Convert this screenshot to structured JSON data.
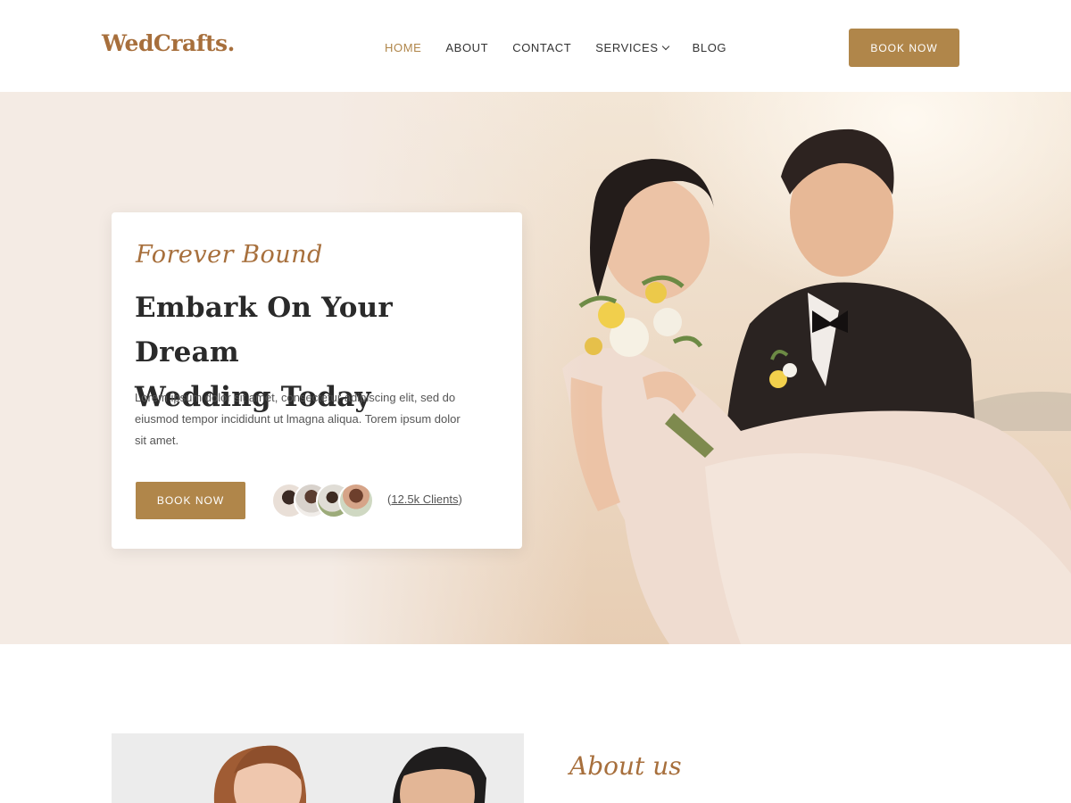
{
  "brand": {
    "logo": "WedCrafts.",
    "accent_color": "#b0864a",
    "logo_color": "#a76f3c"
  },
  "nav": {
    "items": [
      {
        "label": "HOME",
        "active": true
      },
      {
        "label": "ABOUT",
        "active": false
      },
      {
        "label": "CONTACT",
        "active": false
      },
      {
        "label": "SERVICES",
        "active": false,
        "icon": "chevron-down-icon"
      },
      {
        "label": "BLOG",
        "active": false
      }
    ],
    "cta": "BOOK NOW"
  },
  "hero": {
    "script_title": "Forever Bound",
    "headline_line1": "Embark On Your Dream",
    "headline_line2": "Wedding Today",
    "description": "Lorem ipsum dolor sit amet, consectetur adipiscing elit, sed do eiusmod tempor incididunt ut lmagna aliqua. Torem ipsum dolor sit amet.",
    "button": "BOOK NOW",
    "clients_open": "(",
    "clients_text": "12.5k Clients",
    "clients_close": ")",
    "photo": "wedding-couple-photo"
  },
  "about": {
    "script_label": "About us",
    "photo": "couple-portrait-photo"
  }
}
